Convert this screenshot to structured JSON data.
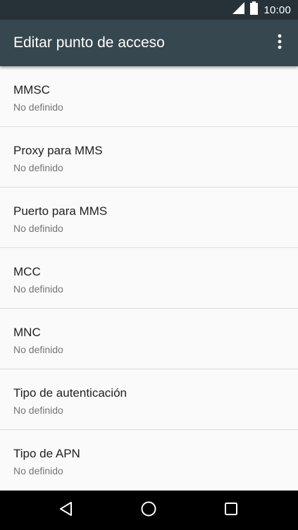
{
  "status_bar": {
    "time": "10:00",
    "icons": [
      "signal-icon",
      "battery-icon"
    ]
  },
  "app_bar": {
    "title": "Editar punto de acceso",
    "menu_icon": "more-vert-icon"
  },
  "settings": [
    {
      "title": "MMSC",
      "summary": "No definido"
    },
    {
      "title": "Proxy para MMS",
      "summary": "No definido"
    },
    {
      "title": "Puerto para MMS",
      "summary": "No definido"
    },
    {
      "title": "MCC",
      "summary": "No definido"
    },
    {
      "title": "MNC",
      "summary": "No definido"
    },
    {
      "title": "Tipo de autenticación",
      "summary": "No definido"
    },
    {
      "title": "Tipo de APN",
      "summary": "No definido"
    }
  ],
  "nav_bar": {
    "icons": [
      "back-icon",
      "home-icon",
      "recents-icon"
    ]
  },
  "colors": {
    "status_bar": "#263238",
    "app_bar": "#37474f",
    "background": "#fafafa",
    "title_text": "#212121",
    "summary_text": "#757575"
  }
}
